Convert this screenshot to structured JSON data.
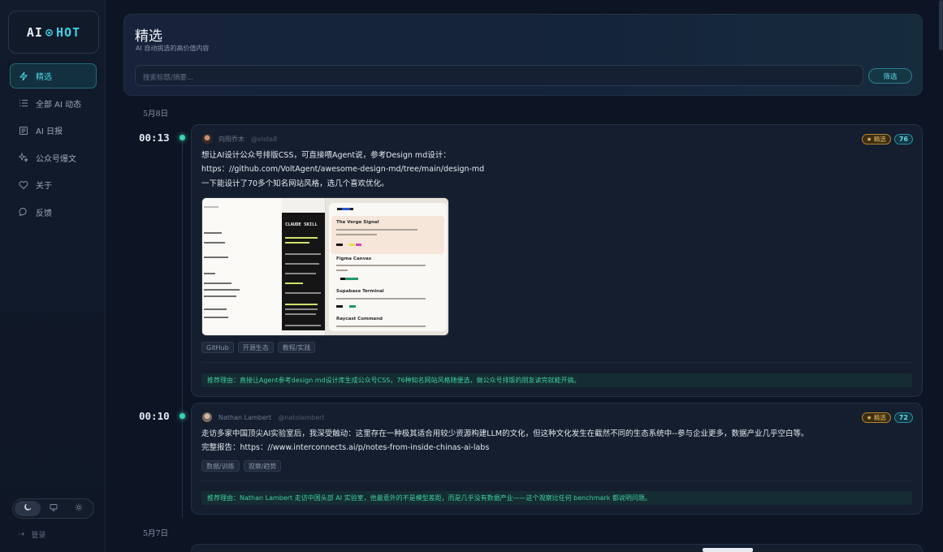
{
  "app": {
    "logo_left": "AI",
    "logo_dot": "⊙",
    "logo_right": "HOT"
  },
  "sidebar": {
    "items": [
      {
        "label": "精选",
        "icon": "bolt-icon",
        "active": true
      },
      {
        "label": "全部 AI 动态",
        "icon": "list-icon"
      },
      {
        "label": "AI 日报",
        "icon": "newspaper-icon"
      },
      {
        "label": "公众号爆文",
        "icon": "sparkle-icon"
      },
      {
        "label": "关于",
        "icon": "heart-icon"
      },
      {
        "label": "反馈",
        "icon": "chat-bubble-icon"
      }
    ],
    "theme": {
      "active": "dark"
    },
    "login_label": "登录"
  },
  "header": {
    "title": "精选",
    "subtitle": "AI 自动挑选的高价值内容",
    "search_placeholder": "搜索标题/摘要...",
    "filter_label": "筛选"
  },
  "dates": [
    "5月8日",
    "5月7日"
  ],
  "posts": [
    {
      "time": "00:13",
      "author": "向阳乔木",
      "handle": "@vista8",
      "badge": "★ 精选",
      "score": "76",
      "lines": [
        "想让AI设计公众号排版CSS，可直接喂Agent说，参考Design md设计：",
        "https：//github.com/VoltAgent/awesome-design-md/tree/main/design-md",
        "一下能设计了70多个知名网站风格，选几个喜欢优化。"
      ],
      "image": {
        "terminal_title": "CLAUDE SKILL",
        "styles": [
          "The Verge Signal",
          "Figma Canvas",
          "Supabase Terminal",
          "Raycast Command"
        ]
      },
      "tags": [
        "GitHub",
        "开源生态",
        "教程/实践"
      ],
      "reason": "推荐理由：直接让Agent参考design md设计库生成公众号CSS，76种知名网站风格随便选，做公众号排版的朋友读完就能开搞。"
    },
    {
      "time": "00:10",
      "author": "Nathan Lambert",
      "handle": "@natolambert",
      "badge": "★ 精选",
      "score": "72",
      "lines": [
        "走访多家中国顶尖AI实验室后，我深受触动：这里存在一种极其适合用较少资源构建LLM的文化，但这种文化发生在截然不同的生态系统中--参与企业更多，数据产业几乎空白等。",
        "完整报告：https：//www.interconnects.ai/p/notes-from-inside-chinas-ai-labs"
      ],
      "tags": [
        "数据/训练",
        "观察/趋势"
      ],
      "reason": "推荐理由：Nathan Lambert 走访中国头部 AI 实验室，他最意外的不是模型差距，而是几乎没有数据产业——这个观察比任何 benchmark 都说明问题。"
    }
  ],
  "colors": {
    "accent": "#3fd0e6",
    "featured": "#f0c15a",
    "reason_green": "#3fce9e",
    "background": "#0d1524"
  }
}
